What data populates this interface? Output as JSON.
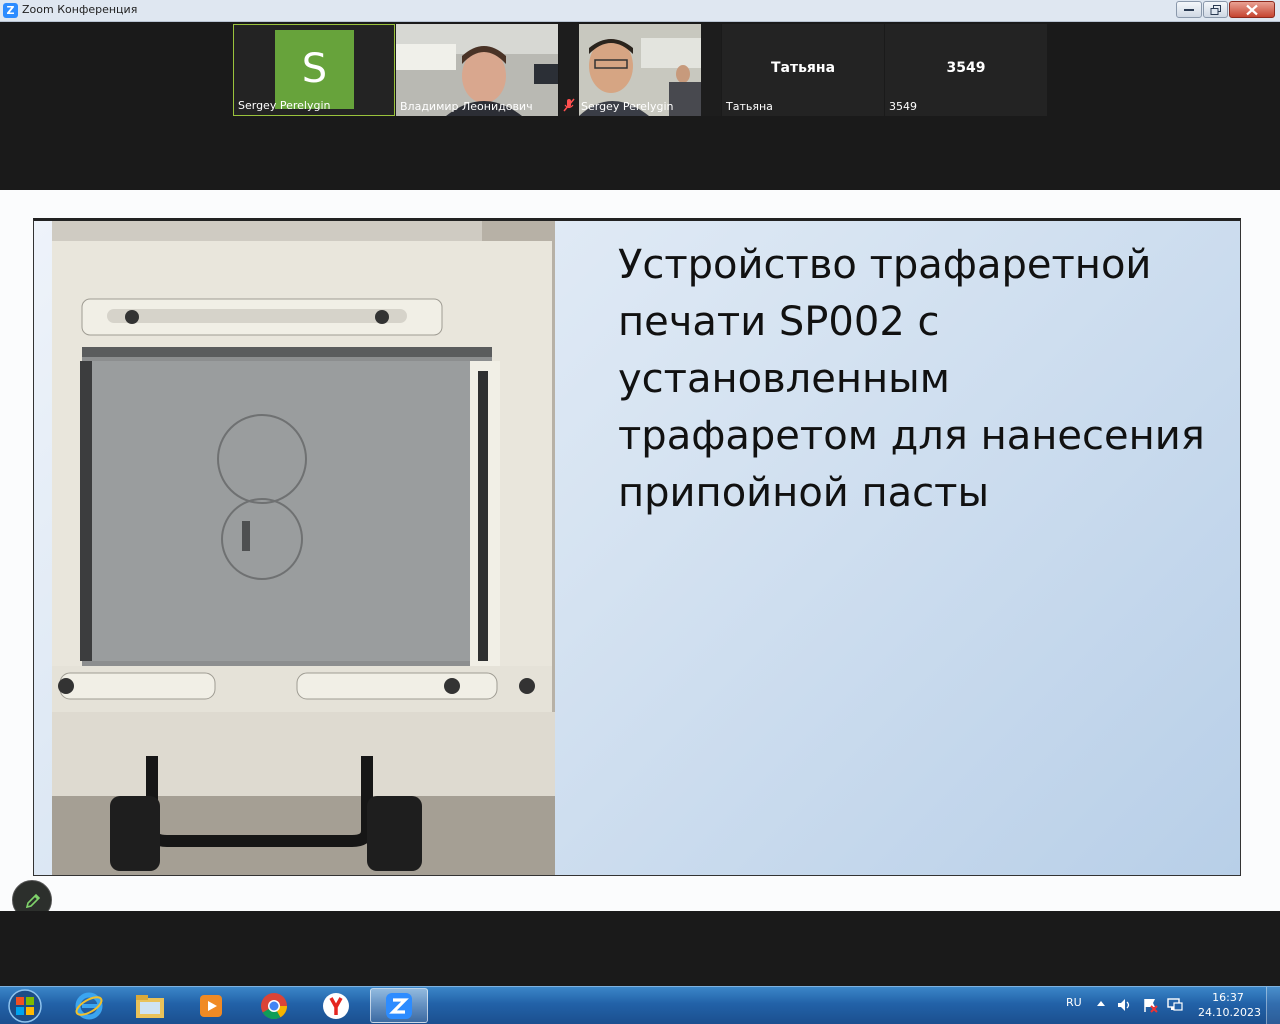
{
  "window": {
    "title": "Zoom Конференция",
    "logo_letter": "Z"
  },
  "participants": [
    {
      "name": "Sergey Perelygin",
      "avatar_letter": "S",
      "kind": "avatar",
      "active": true
    },
    {
      "name": "Владимир Леонидович",
      "kind": "video"
    },
    {
      "name": "Sergey Perelygin",
      "kind": "video",
      "muted": true
    },
    {
      "name": "Татьяна",
      "center_label": "Татьяна",
      "kind": "text"
    },
    {
      "name": "3549",
      "center_label": "3549",
      "kind": "text"
    }
  ],
  "slide": {
    "title": "Устройство трафаретной печати SP002 с установленным трафаретом для нанесения припойной пасты"
  },
  "annotate": {
    "icon": "pencil-icon"
  },
  "taskbar": {
    "items": [
      "ie-icon",
      "explorer-icon",
      "media-player-icon",
      "chrome-icon",
      "yandex-icon",
      "zoom-icon"
    ],
    "language": "RU",
    "time": "16:37",
    "date": "24.10.2023"
  },
  "colors": {
    "active_speaker_border": "#9ac23c",
    "avatar_bg": "#67a33b",
    "zoom_blue": "#2d8cff"
  }
}
